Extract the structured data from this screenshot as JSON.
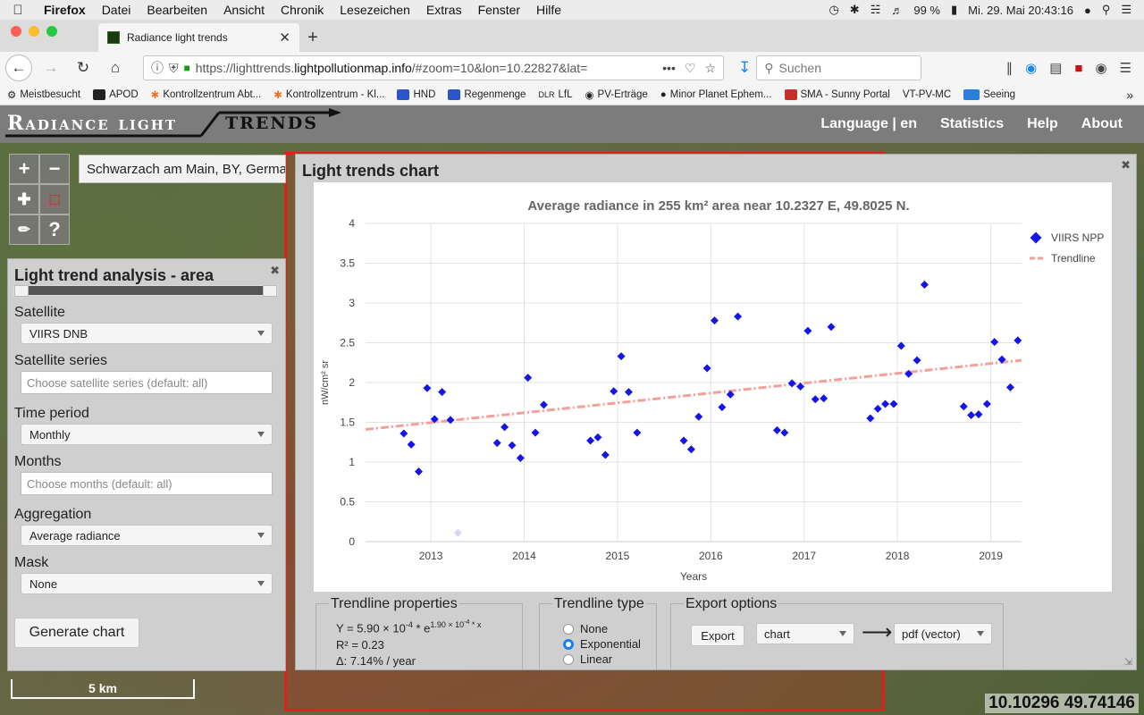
{
  "menubar": {
    "app": "Firefox",
    "items": [
      "Datei",
      "Bearbeiten",
      "Ansicht",
      "Chronik",
      "Lesezeichen",
      "Extras",
      "Fenster",
      "Hilfe"
    ],
    "battery": "99 %",
    "datetime": "Mi. 29. Mai  20:43:16"
  },
  "tab": {
    "title": "Radiance light trends"
  },
  "navbar": {
    "url_prefix": "https://lighttrends.",
    "url_domain": "lightpollutionmap.info",
    "url_rest": "/#zoom=10&lon=10.22827&lat=",
    "search_placeholder": "Suchen"
  },
  "bookmarks": [
    "Meistbesucht",
    "APOD",
    "Kontrollzentrum Abt...",
    "Kontrollzentrum - Kl...",
    "HND",
    "Regenmenge",
    "LfL",
    "PV-Erträge",
    "Minor Planet Ephem...",
    "SMA - Sunny Portal",
    "VT-PV-MC",
    "Seeing"
  ],
  "header": {
    "logo_part1": "Radiance light",
    "logo_part2": "trends",
    "nav": [
      "Language | en",
      "Statistics",
      "Help",
      "About"
    ]
  },
  "map": {
    "place_search": "Schwarzach am Main, BY, Germany",
    "scale_label": "5 km",
    "coords": "10.10296 49.74146"
  },
  "left_panel": {
    "title": "Light trend analysis - area",
    "satellite_label": "Satellite",
    "satellite_value": "VIIRS DNB",
    "series_label": "Satellite series",
    "series_placeholder": "Choose satellite series (default: all)",
    "period_label": "Time period",
    "period_value": "Monthly",
    "months_label": "Months",
    "months_placeholder": "Choose months (default: all)",
    "aggregation_label": "Aggregation",
    "aggregation_value": "Average radiance",
    "mask_label": "Mask",
    "mask_value": "None",
    "generate_label": "Generate chart"
  },
  "chart_dialog": {
    "title": "Light trends chart",
    "trend_props_legend": "Trendline properties",
    "trend_eq_base": "Y = 5.90 × 10",
    "trend_eq_exp1": "-4",
    "trend_eq_mid": " * e",
    "trend_eq_exp2": "1.90 × 10",
    "trend_eq_exp3": "-4",
    "trend_eq_exp4": " * x",
    "r2": "R² = 0.23",
    "delta": "Δ: 7.14% / year",
    "trend_type_legend": "Trendline type",
    "trend_types": [
      "None",
      "Exponential",
      "Linear"
    ],
    "trend_selected": 1,
    "export_legend": "Export options",
    "export_button": "Export",
    "export_what": "chart",
    "export_format": "pdf (vector)"
  },
  "colors": {
    "series": "#1515e8",
    "trend": "#f4a098",
    "red_area": "#e0201a"
  },
  "chart_data": {
    "type": "scatter",
    "title": "Average radiance in 255 km² area near 10.2327 E, 49.8025 N.",
    "xlabel": "Years",
    "ylabel": "nW/cm² sr",
    "xlim": [
      2012.3,
      2019.33
    ],
    "ylim": [
      0,
      4
    ],
    "xticks": [
      "2013",
      "2014",
      "2015",
      "2016",
      "2017",
      "2018",
      "2019"
    ],
    "yticks": [
      "0",
      "0.5",
      "1",
      "1.5",
      "2",
      "2.5",
      "3",
      "3.5",
      "4"
    ],
    "legend_position": "top-right",
    "series": [
      {
        "name": "VIIRS NPP",
        "x": [
          2012.71,
          2012.79,
          2012.87,
          2012.96,
          2013.04,
          2013.12,
          2013.21,
          2013.29,
          2013.71,
          2013.79,
          2013.87,
          2013.96,
          2014.04,
          2014.12,
          2014.21,
          2014.71,
          2014.79,
          2014.87,
          2014.96,
          2015.04,
          2015.12,
          2015.21,
          2015.71,
          2015.79,
          2015.87,
          2015.96,
          2016.04,
          2016.12,
          2016.21,
          2016.29,
          2016.71,
          2016.79,
          2016.87,
          2016.96,
          2017.04,
          2017.12,
          2017.21,
          2017.29,
          2017.71,
          2017.79,
          2017.87,
          2017.96,
          2018.04,
          2018.12,
          2018.21,
          2018.29,
          2018.71,
          2018.79,
          2018.87,
          2018.96,
          2019.04,
          2019.12,
          2019.21,
          2019.29
        ],
        "y": [
          1.36,
          1.22,
          0.88,
          1.93,
          1.54,
          1.88,
          1.53,
          0.11,
          1.24,
          1.44,
          1.21,
          1.05,
          2.06,
          1.37,
          1.72,
          1.27,
          1.31,
          1.09,
          1.89,
          2.33,
          1.88,
          1.37,
          1.27,
          1.16,
          1.57,
          2.18,
          2.78,
          1.69,
          1.85,
          2.83,
          1.4,
          1.37,
          1.99,
          1.95,
          2.65,
          1.79,
          1.8,
          2.7,
          1.55,
          1.67,
          1.73,
          1.73,
          2.46,
          2.11,
          2.28,
          3.23,
          1.7,
          1.59,
          1.6,
          1.73,
          2.51,
          2.29,
          1.94,
          2.53
        ],
        "faded": [
          7
        ]
      },
      {
        "name": "Trendline",
        "x": [
          2012.3,
          2019.33
        ],
        "y": [
          1.41,
          2.28
        ]
      }
    ]
  }
}
